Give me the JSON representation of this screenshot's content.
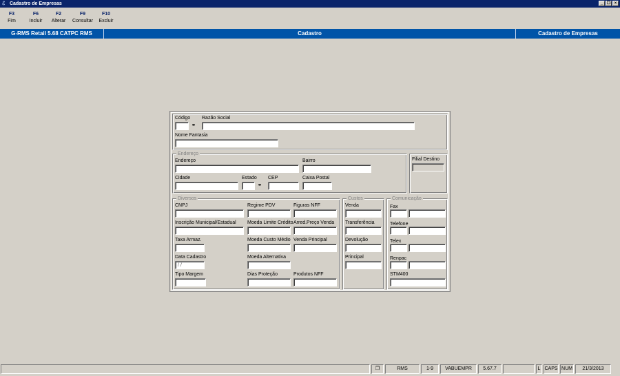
{
  "window": {
    "title": "Cadastro de Empresas"
  },
  "toolbar": {
    "keys": [
      {
        "key": "F3",
        "label": "Fim"
      },
      {
        "key": "F6",
        "label": "Incluir"
      },
      {
        "key": "F2",
        "label": "Alterar"
      },
      {
        "key": "F9",
        "label": "Consultar"
      },
      {
        "key": "F10",
        "label": "Excluir"
      }
    ]
  },
  "header": {
    "app": "G-RMS Retail 5.68 CATPC RMS",
    "section": "Cadastro",
    "screen": "Cadastro de Empresas"
  },
  "form": {
    "codigo": "Código",
    "razao_social": "Razão Social",
    "nome_fantasia": "Nome Fantasia",
    "endereco_group": "Endereço",
    "endereco": "Endereço",
    "bairro": "Bairro",
    "cidade": "Cidade",
    "estado": "Estado",
    "cep": "CEP",
    "caixa_postal": "Caixa Postal",
    "filial_destino": "Filial Destino",
    "diversos_group": "Diversos",
    "cnpj": "CNPJ",
    "regime_pdv": "Regime PDV",
    "figuras_nff": "Figuras NFF",
    "inscricao": "Inscrição Municipal/Estadual",
    "moeda_limite": "Moeda Limite Crédito",
    "arred_preco": "Arred.Preço Venda",
    "taxa_armaz": "Taxa Armaz.",
    "moeda_custo": "Moeda Custo Médio",
    "venda_principal": "Venda Principal",
    "data_cadastro": "Data Cadastro",
    "data_cadastro_value": " /  /",
    "moeda_alternativa": "Moeda Alternativa",
    "tipo_margem": "Tipo Margem",
    "dias_protecao": "Dias Proteção",
    "produtos_nff": "Produtos NFF",
    "custos_group": "Custos",
    "venda": "Venda",
    "transferencia": "Transferência",
    "devolucao": "Devolução",
    "principal": "Principal",
    "comunicacao_group": "Comunicação",
    "fax": "Fax",
    "telefone": "Telefone",
    "telex": "Telex",
    "renpac": "Renpac",
    "stm400": "STM400"
  },
  "status": {
    "cells": [
      "RMS",
      "1-9",
      "VABUEMPR",
      "5.67.7",
      "L",
      "CAPS",
      "NUM",
      "21/3/2013"
    ]
  }
}
